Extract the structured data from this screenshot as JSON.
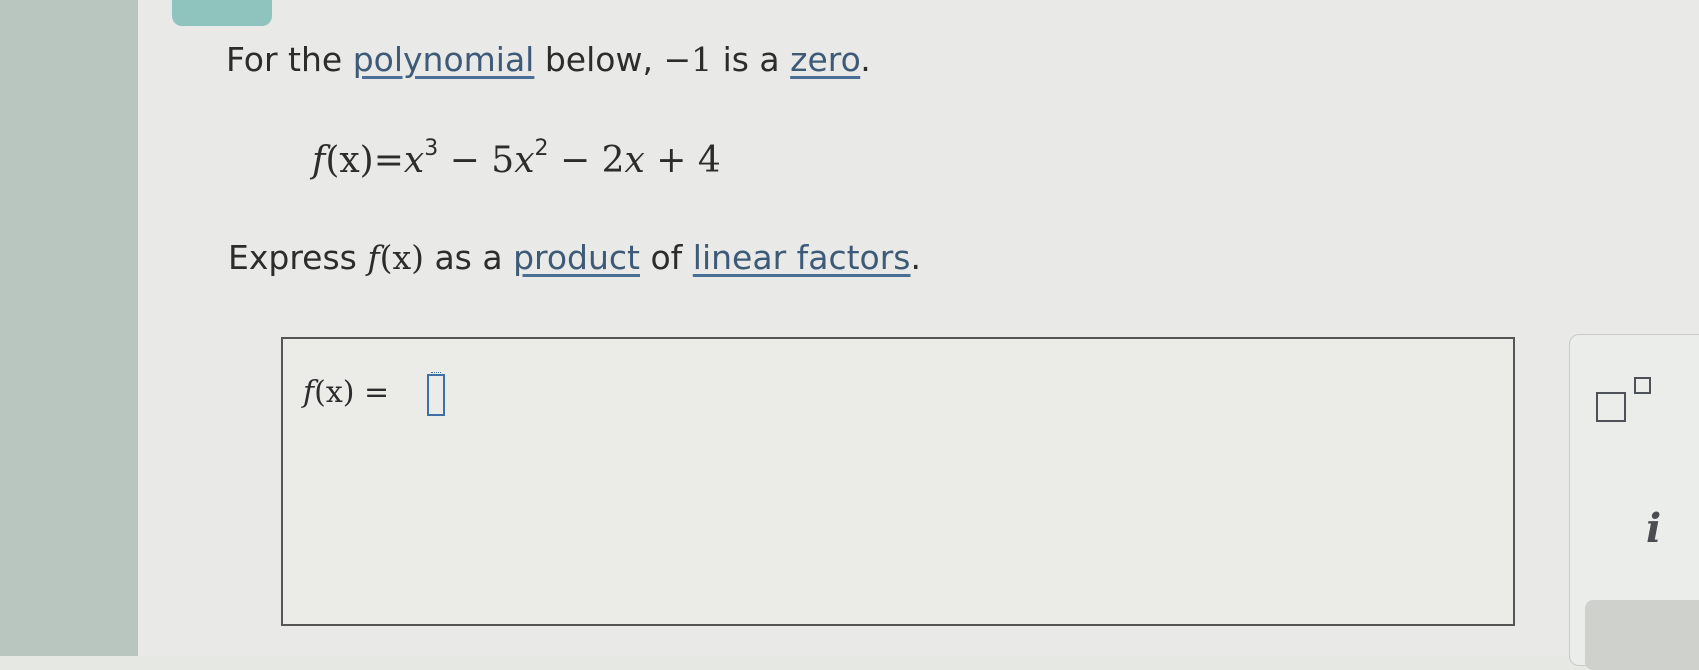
{
  "question": {
    "intro_prefix": "For the ",
    "intro_link1": "polynomial",
    "intro_middle": " below, ",
    "zero_value": "−1",
    "intro_is_a": " is a ",
    "intro_link2": "zero",
    "intro_end": ".",
    "equation": {
      "lhs_f": "f",
      "lhs_x": "(x)",
      "equals": "=",
      "t1_var": "x",
      "t1_exp": "3",
      "minus1": " − ",
      "t2_coef": "5",
      "t2_var": "x",
      "t2_exp": "2",
      "minus2": " − ",
      "t3_coef": "2",
      "t3_var": "x",
      "plus": " + ",
      "t4": "4"
    },
    "express_prefix": "Express ",
    "express_f": "f",
    "express_x": "(x)",
    "express_middle": " as a ",
    "express_link1": "product",
    "express_of": " of ",
    "express_link2": "linear factors",
    "express_end": "."
  },
  "answer": {
    "label_f": "f",
    "label_x": "(x)",
    "label_eq": " = ",
    "value": ""
  },
  "toolbar": {
    "exponent_button": "exponent-template",
    "info_button": "i"
  },
  "colors": {
    "input_border": "#3f6fa6",
    "link": "#3d5a78"
  }
}
